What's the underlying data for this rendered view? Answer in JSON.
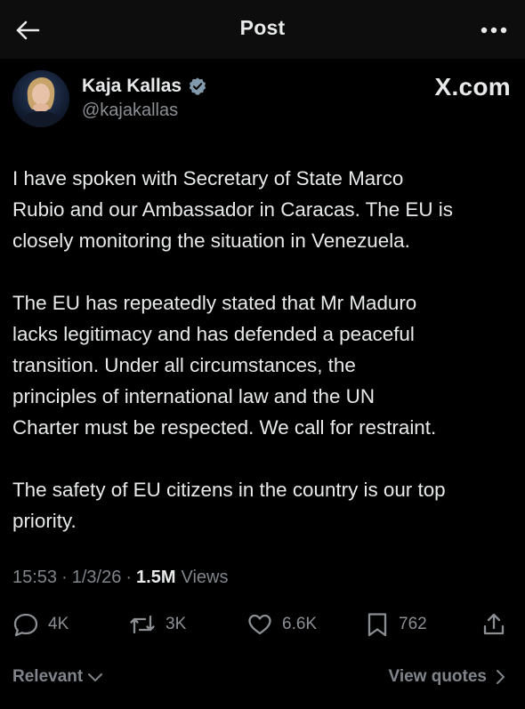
{
  "header": {
    "title": "Post",
    "back_icon": "arrow-left-icon",
    "more_icon": "more-horizontal-icon"
  },
  "author": {
    "name": "Kaja Kallas",
    "handle": "@kajakallas",
    "verified_icon": "verified-badge-icon",
    "verified_color": "#829aab"
  },
  "watermark": "X.com",
  "post": {
    "paragraphs": [
      "I have spoken with Secretary of State Marco\nRubio and our Ambassador in Caracas. The EU is\nclosely monitoring the situation in Venezuela.",
      "The EU has repeatedly stated that Mr Maduro\nlacks legitimacy and has defended a peaceful\ntransition. Under all circumstances, the\nprinciples of international law and the UN\nCharter must be respected. We call for restraint.",
      "The safety of EU citizens in the country is our top\npriority."
    ]
  },
  "meta": {
    "time": "15:53",
    "date": "1/3/26",
    "views_count": "1.5M",
    "views_label": "Views"
  },
  "actions": {
    "replies": "4K",
    "reposts": "3K",
    "likes": "6.6K",
    "bookmarks": "762",
    "icons": [
      "reply-icon",
      "repost-icon",
      "like-icon",
      "bookmark-icon",
      "share-icon"
    ]
  },
  "footer": {
    "sort_label": "Relevant",
    "quotes_label": "View quotes"
  },
  "colors": {
    "background": "#000000",
    "text": "#e7e9ea",
    "secondary_text": "#8b8f94"
  }
}
